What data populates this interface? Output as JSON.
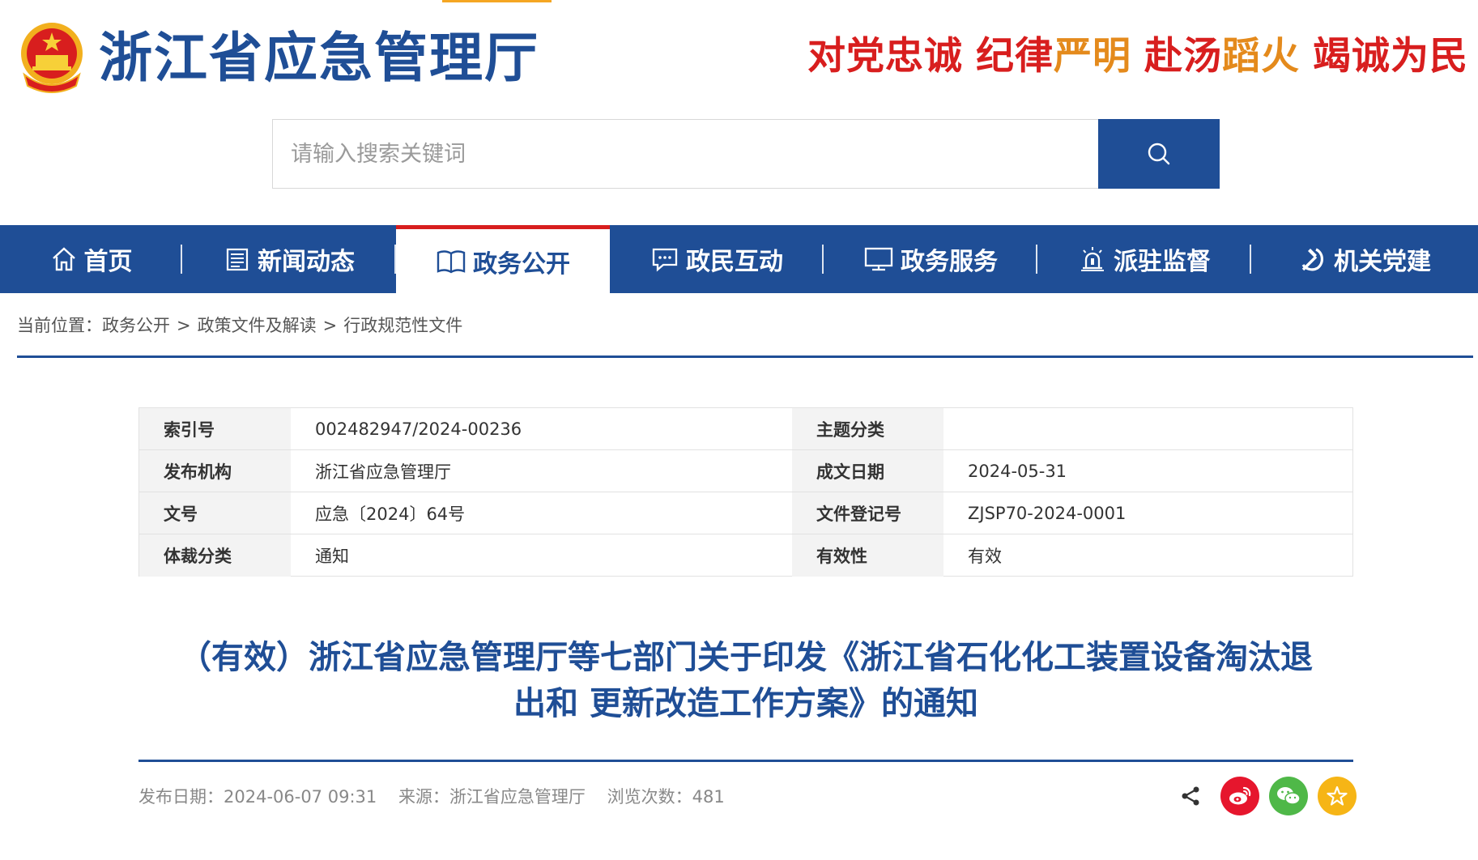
{
  "header": {
    "site_title": "浙江省应急管理厅",
    "slogan": [
      "对党忠诚",
      "纪律严明",
      "赴汤蹈火",
      "竭诚为民"
    ],
    "slogan_colors": {
      "red": "#d81e1e",
      "gold": "#e48a1c"
    }
  },
  "search": {
    "placeholder": "请输入搜索关键词",
    "button_icon": "search-icon"
  },
  "nav": {
    "items": [
      {
        "label": "首页",
        "icon": "home-icon"
      },
      {
        "label": "新闻动态",
        "icon": "newspaper-icon"
      },
      {
        "label": "政务公开",
        "icon": "book-icon",
        "active": true
      },
      {
        "label": "政民互动",
        "icon": "chat-icon"
      },
      {
        "label": "政务服务",
        "icon": "monitor-icon"
      },
      {
        "label": "派驻监督",
        "icon": "alarm-icon"
      },
      {
        "label": "机关党建",
        "icon": "hammer-sickle-icon"
      }
    ]
  },
  "breadcrumb": {
    "prefix": "当前位置：",
    "items": [
      "政务公开",
      "政策文件及解读",
      "行政规范性文件"
    ],
    "separator": ">"
  },
  "meta": {
    "rows": [
      [
        {
          "k": "索引号",
          "v": "002482947/2024-00236"
        },
        {
          "k": "主题分类",
          "v": ""
        }
      ],
      [
        {
          "k": "发布机构",
          "v": "浙江省应急管理厅"
        },
        {
          "k": "成文日期",
          "v": "2024-05-31"
        }
      ],
      [
        {
          "k": "文号",
          "v": "应急〔2024〕64号"
        },
        {
          "k": "文件登记号",
          "v": "ZJSP70-2024-0001"
        }
      ],
      [
        {
          "k": "体裁分类",
          "v": "通知"
        },
        {
          "k": "有效性",
          "v": "有效"
        }
      ]
    ]
  },
  "article": {
    "title_line1": "（有效）浙江省应急管理厅等七部门关于印发《浙江省石化化工装置设备淘汰退",
    "title_line2": "出和 更新改造工作方案》的通知"
  },
  "info": {
    "publish_date": "发布日期：2024-06-07 09:31",
    "source": "来源：浙江省应急管理厅",
    "views": "浏览次数：481"
  },
  "colors": {
    "brand": "#1f4e96",
    "active_bar": "#d81e1e",
    "accent_top": "#f5a623"
  }
}
